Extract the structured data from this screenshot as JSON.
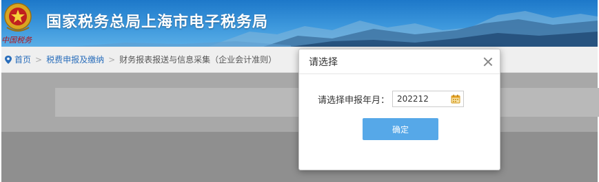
{
  "header": {
    "title": "国家税务总局上海市电子税务局",
    "emblem_icon": "tax-emblem-icon",
    "emblem_caption": "中国税务",
    "brand_color": "#1d78c9"
  },
  "breadcrumb": {
    "home": "首页",
    "level1": "税费申报及缴纳",
    "current": "财务报表报送与信息采集（企业会计准则）",
    "separator": ">"
  },
  "dialog": {
    "title": "请选择",
    "field_label": "请选择申报年月：",
    "field_value": "202212",
    "confirm_label": "确定",
    "accent_color": "#56a8e8"
  }
}
